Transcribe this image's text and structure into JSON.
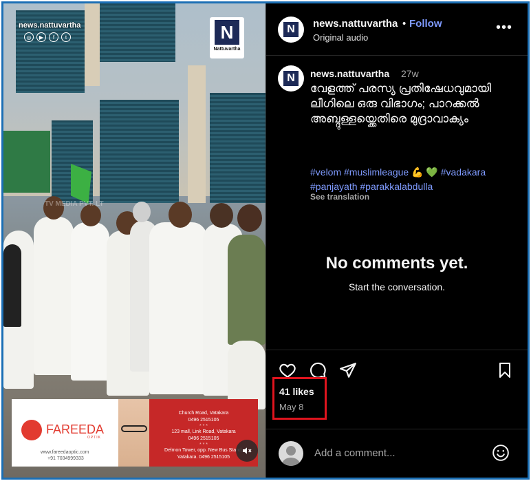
{
  "video": {
    "watermark_site": "news.nattuvartha",
    "social_icons": [
      "instagram-icon",
      "youtube-icon",
      "facebook-icon",
      "twitter-icon"
    ],
    "logo_mark": "N",
    "logo_text": "Nattuvartha",
    "tv_watermark": "TV MEDIA PVT. LT",
    "ad": {
      "brand": "FAREEDA",
      "brand_sub": "OPTIK",
      "website": "www.fareedaoptic.com",
      "phone": "+91 7034999333",
      "lines": [
        "Church Road, Vatakara",
        "0496 2515105",
        "* * *",
        "123 mall, Link Road, Vatakara",
        "0496 2515105",
        "* * *",
        "Delmon Tower, opp. New Bus Stand,",
        "Vatakara. 0496 2515105"
      ]
    },
    "mute_icon": "speaker-muted-icon"
  },
  "header": {
    "username": "news.nattuvartha",
    "separator": "•",
    "follow_label": "Follow",
    "audio_label": "Original audio",
    "more_icon": "more-options-icon"
  },
  "caption": {
    "username": "news.nattuvartha",
    "time": "27w",
    "text": "വേളത്ത് പരസ്യ പ്രതിഷേധവുമായി ലീഗിലെ ഒരു വിഭാഗം; പാറക്കൽ അബ്ദുള്ളയ്ക്കെതിരെ മുദ്രാവാക്യം",
    "hashtags_line1": "#velom #muslimleague",
    "emoji_flex": "💪",
    "emoji_heart": "💚",
    "hashtag_vadakara": "#vadakara",
    "hashtags_line2": "#panjayath #parakkalabdulla",
    "see_translation": "See translation"
  },
  "comments": {
    "empty_title": "No comments yet.",
    "empty_subtitle": "Start the conversation."
  },
  "actions": {
    "likes": "41 likes",
    "date": "May 8",
    "icons": [
      "heart-icon",
      "comment-icon",
      "share-icon",
      "save-icon"
    ]
  },
  "comment_input": {
    "placeholder": "Add a comment...",
    "emoji_icon": "emoji-icon"
  },
  "colors": {
    "accent_link": "#7f9bff",
    "highlight_box": "#e0141e",
    "frame_border": "#1b6fb5",
    "ad_red": "#c62828"
  }
}
